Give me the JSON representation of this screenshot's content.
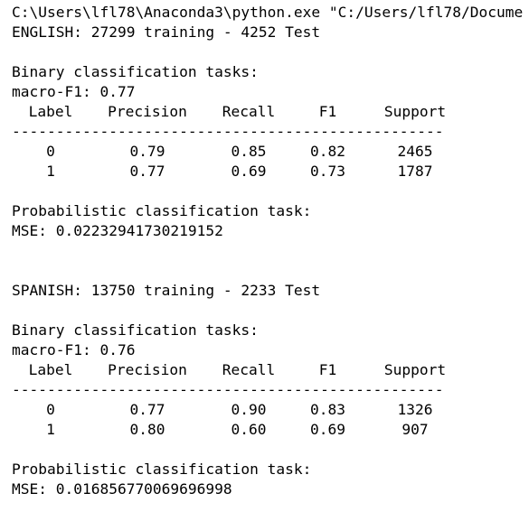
{
  "console": {
    "command": "C:\\Users\\lfl78\\Anaconda3\\python.exe \"C:/Users/lfl78/Docume",
    "separator": "-------------------------------------------------",
    "headers": [
      "Label",
      "Precision",
      "Recall",
      "F1",
      "Support"
    ],
    "sections": [
      {
        "dataset_line": "ENGLISH: 27299 training - 4252 Test",
        "binary_title": "Binary classification tasks:",
        "macro_f1": "macro-F1: 0.77",
        "rows": [
          {
            "label": "0",
            "precision": "0.79",
            "recall": "0.85",
            "f1": "0.82",
            "support": "2465"
          },
          {
            "label": "1",
            "precision": "0.77",
            "recall": "0.69",
            "f1": "0.73",
            "support": "1787"
          }
        ],
        "prob_title": "Probabilistic classification task:",
        "mse": "MSE: 0.02232941730219152"
      },
      {
        "dataset_line": "SPANISH: 13750 training - 2233 Test",
        "binary_title": "Binary classification tasks:",
        "macro_f1": "macro-F1: 0.76",
        "rows": [
          {
            "label": "0",
            "precision": "0.77",
            "recall": "0.90",
            "f1": "0.83",
            "support": "1326"
          },
          {
            "label": "1",
            "precision": "0.80",
            "recall": "0.60",
            "f1": "0.69",
            "support": "907"
          }
        ],
        "prob_title": "Probabilistic classification task:",
        "mse": "MSE: 0.016856770069696998"
      }
    ]
  }
}
